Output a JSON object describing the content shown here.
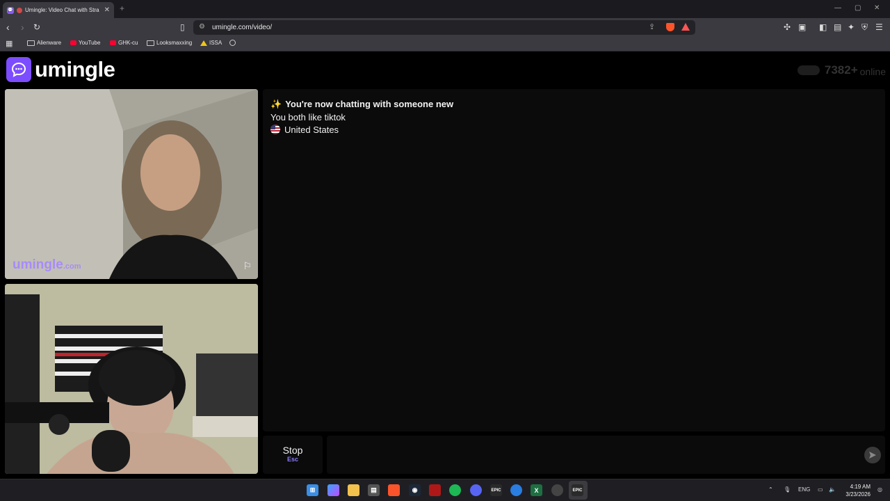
{
  "browser": {
    "tab_title": "Umingle: Video Chat with Stra",
    "url": "umingle.com/video/",
    "bookmarks": [
      "Alienware",
      "YouTube",
      "GHK-cu",
      "Looksmaxxing",
      "ISSA"
    ]
  },
  "header": {
    "logo_text": "umingle",
    "online_count": "7382+",
    "online_label": "online"
  },
  "stranger_video": {
    "watermark": "umingle",
    "watermark_suffix": ".com"
  },
  "chat": {
    "headline": "You're now chatting with someone new",
    "headline_icon": "sparkles-icon",
    "common_interest": "You both like tiktok",
    "country": "United States"
  },
  "controls": {
    "stop_label": "Stop",
    "stop_shortcut": "Esc",
    "message_placeholder": ""
  },
  "taskbar": {
    "language": "ENG",
    "time": "4:19 AM",
    "date": "3/23/2026"
  },
  "colors": {
    "brand": "#7c4dff",
    "shortcut": "#8b7bff",
    "panel": "#0b0b0b"
  }
}
